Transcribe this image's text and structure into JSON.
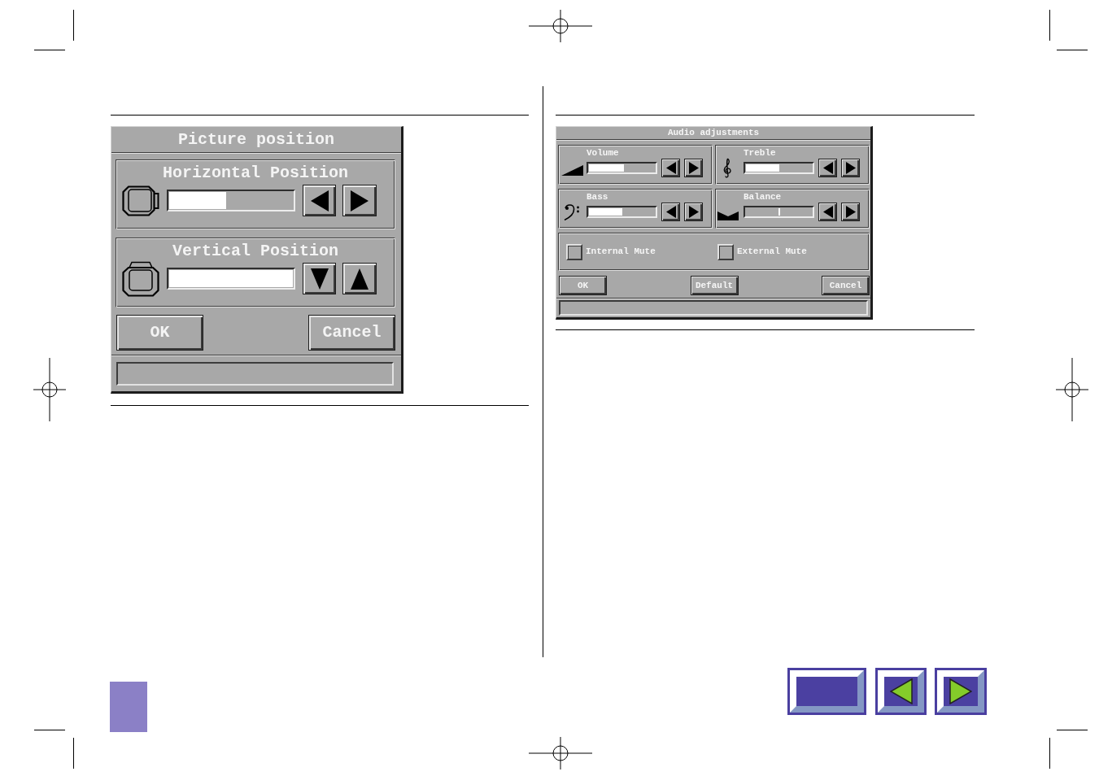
{
  "picture_position": {
    "title": "Picture position",
    "controls": [
      {
        "kind": "horizontal",
        "label": "Horizontal Position",
        "level": 0.46
      },
      {
        "kind": "vertical",
        "label": "Vertical Position",
        "level": 1
      }
    ],
    "buttons": [
      {
        "label": "OK"
      },
      {
        "label": "Cancel"
      }
    ]
  },
  "audio_adjustments": {
    "title": "Audio adjustments",
    "controls": [
      {
        "kind": "volume",
        "label": "Volume",
        "level": 0.53
      },
      {
        "kind": "treble",
        "label": "Treble",
        "level": 0.5
      },
      {
        "kind": "bass",
        "label": "Bass",
        "level": 0.51
      },
      {
        "kind": "balance",
        "label": "Balance",
        "level": 0.5
      }
    ],
    "checkboxes": [
      {
        "label": "Internal Mute",
        "checked": false
      },
      {
        "label": "External Mute",
        "checked": false
      }
    ],
    "buttons": [
      {
        "label": "OK"
      },
      {
        "label": "Default"
      },
      {
        "label": "Cancel"
      }
    ]
  }
}
